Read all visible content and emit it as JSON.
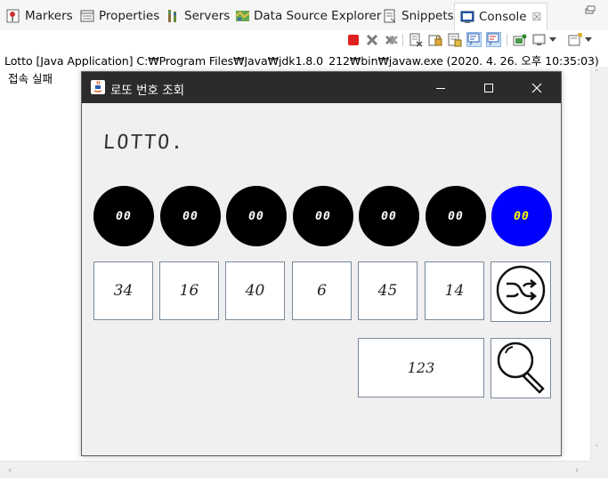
{
  "tabs": [
    {
      "label": "Markers",
      "icon": "markers-icon"
    },
    {
      "label": "Properties",
      "icon": "properties-icon"
    },
    {
      "label": "Servers",
      "icon": "servers-icon"
    },
    {
      "label": "Data Source Explorer",
      "icon": "data-source-explorer-icon"
    },
    {
      "label": "Snippets",
      "icon": "snippets-icon"
    },
    {
      "label": "Console",
      "icon": "console-icon",
      "active": true
    }
  ],
  "console": {
    "title": "Lotto [Java Application] C:₩Program Files₩Java₩jdk1.8.0_212₩bin₩javaw.exe (2020. 4. 26. 오후 10:35:03)",
    "output": "접속 실패"
  },
  "window": {
    "title": "로또 번호 조회",
    "logo": "LOTTO.",
    "balls": [
      "00",
      "00",
      "00",
      "00",
      "00",
      "00",
      "00"
    ],
    "bonus_color": "#0000ff",
    "bonus_text_color": "#ffff00",
    "numbers": [
      "34",
      "16",
      "40",
      "6",
      "45",
      "14"
    ],
    "round": "123",
    "shuffle_icon": "shuffle-icon",
    "search_icon": "search-icon"
  },
  "colors": {
    "titlebar": "#2b2b2b",
    "terminate_red": "#e02020"
  }
}
